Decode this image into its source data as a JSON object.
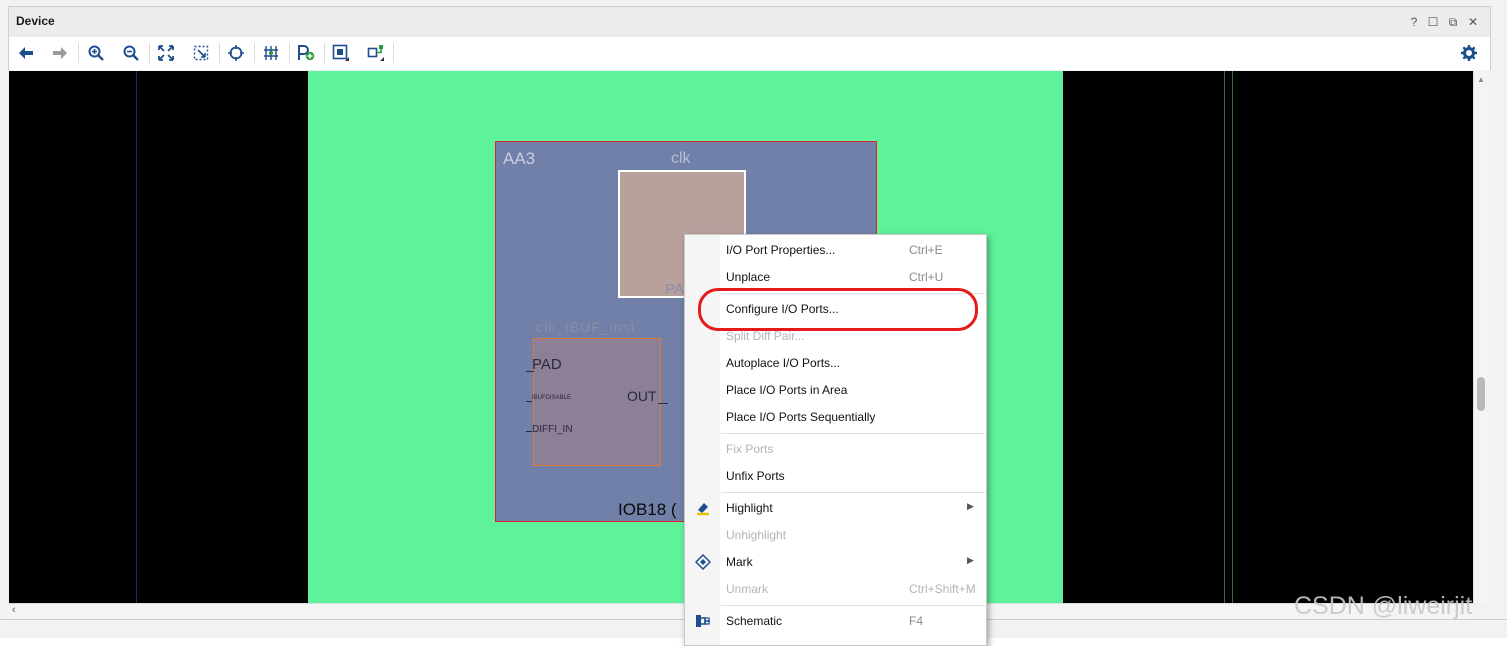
{
  "window": {
    "title": "Device",
    "controls": {
      "help": "?",
      "restore": "☐",
      "float": "⧉",
      "close": "✕"
    }
  },
  "toolbar": {
    "buttons": [
      {
        "icon": "back-arrow-icon"
      },
      {
        "icon": "forward-arrow-icon"
      },
      {
        "icon": "zoom-in-icon"
      },
      {
        "icon": "zoom-out-icon"
      },
      {
        "icon": "zoom-fit-icon"
      },
      {
        "icon": "zoom-area-icon"
      },
      {
        "icon": "auto-fit-selection-icon"
      },
      {
        "icon": "routing-resources-icon"
      },
      {
        "icon": "add-pblock-icon"
      },
      {
        "icon": "pblock-icon"
      },
      {
        "icon": "place-ports-icon"
      }
    ],
    "settings_icon": "gear-icon"
  },
  "device_view": {
    "site_name": "AA3",
    "port_name": "clk",
    "pad_label": "PA",
    "ibuf_label": "clk_IBUF_inst",
    "ibuf_pins": {
      "pad": "PAD",
      "out": "OUT",
      "small": "IBUFDISABLE",
      "diff": "DIFFI_IN"
    },
    "iob_label": "IOB18 (",
    "colors": {
      "clock_region": "#5ef29b",
      "site": "#7180a8",
      "site_border": "#e02020"
    }
  },
  "context_menu": {
    "items": [
      {
        "label": "I/O Port Properties...",
        "shortcut": "Ctrl+E",
        "enabled": true
      },
      {
        "label": "Unplace",
        "shortcut": "Ctrl+U",
        "enabled": true
      },
      {
        "label": "Configure I/O Ports...",
        "shortcut": "",
        "enabled": true,
        "highlighted": true
      },
      {
        "label": "Split Diff Pair...",
        "shortcut": "",
        "enabled": false
      },
      {
        "label": "Autoplace I/O Ports...",
        "shortcut": "",
        "enabled": true
      },
      {
        "label": "Place I/O Ports in Area",
        "shortcut": "",
        "enabled": true
      },
      {
        "label": "Place I/O Ports Sequentially",
        "shortcut": "",
        "enabled": true
      },
      {
        "label": "Fix Ports",
        "shortcut": "",
        "enabled": false
      },
      {
        "label": "Unfix Ports",
        "shortcut": "",
        "enabled": true
      },
      {
        "label": "Highlight",
        "shortcut": "",
        "enabled": true,
        "submenu": true,
        "icon": "highlight-pen-icon"
      },
      {
        "label": "Unhighlight",
        "shortcut": "",
        "enabled": false
      },
      {
        "label": "Mark",
        "shortcut": "",
        "enabled": true,
        "submenu": true,
        "icon": "mark-diamond-icon"
      },
      {
        "label": "Unmark",
        "shortcut": "Ctrl+Shift+M",
        "enabled": false
      },
      {
        "label": "Schematic",
        "shortcut": "F4",
        "enabled": true,
        "icon": "schematic-icon"
      }
    ]
  },
  "watermark": "CSDN @liweirjit"
}
